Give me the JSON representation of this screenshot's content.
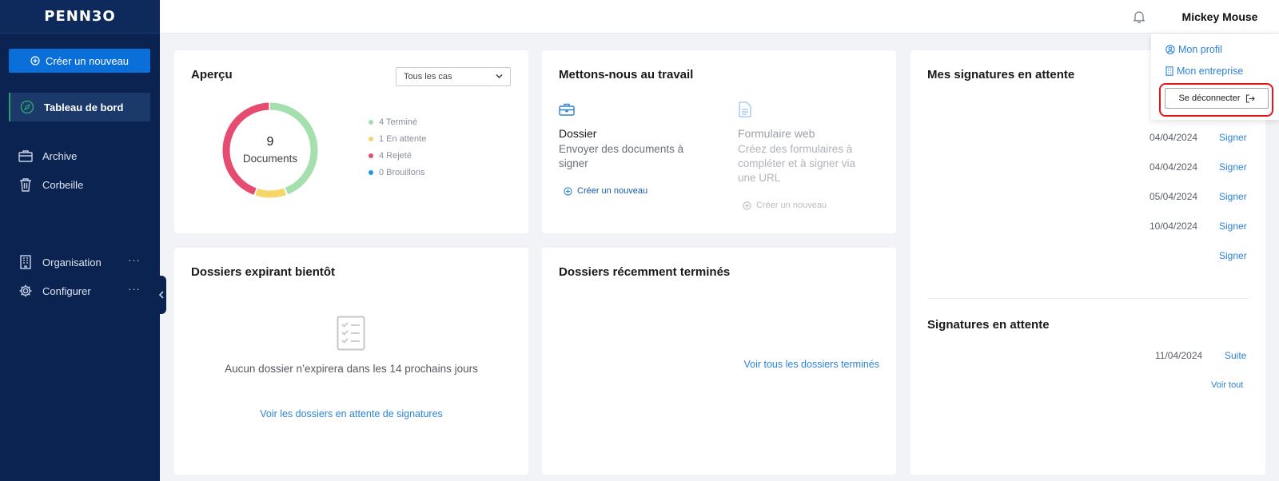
{
  "sidebar": {
    "logo": "PENN3O",
    "create_label": "Créer un nouveau",
    "items": [
      {
        "label": "Tableau de bord"
      },
      {
        "label": "Archive"
      },
      {
        "label": "Corbeille"
      },
      {
        "label": "Organisation",
        "more": "···"
      },
      {
        "label": "Configurer",
        "more": "···"
      }
    ]
  },
  "header": {
    "user_name": "Mickey Mouse"
  },
  "user_menu": {
    "profile": "Mon profil",
    "company": "Mon entreprise",
    "logout": "Se déconnecter"
  },
  "overview": {
    "title": "Aperçu",
    "filter_value": "Tous les cas",
    "center_count": "9",
    "center_label": "Documents",
    "legend": [
      {
        "label": "4 Terminé",
        "color": "#a5dfad"
      },
      {
        "label": "1 En attente",
        "color": "#f6d56b"
      },
      {
        "label": "4 Rejeté",
        "color": "#e64b70"
      },
      {
        "label": "0 Brouillons",
        "color": "#1d95e8"
      }
    ]
  },
  "chart_data": {
    "type": "pie",
    "categories": [
      "Terminé",
      "En attente",
      "Rejeté",
      "Brouillons"
    ],
    "values": [
      4,
      1,
      4,
      0
    ],
    "colors": [
      "#a5dfad",
      "#f6d56b",
      "#e64b70",
      "#1d95e8"
    ]
  },
  "work": {
    "title": "Mettons-nous au travail",
    "dossier_title": "Dossier",
    "dossier_desc": "Envoyer des documents à signer",
    "dossier_link": "Créer un nouveau",
    "form_title": "Formulaire web",
    "form_desc": "Créez des formulaires à compléter et à signer via une URL",
    "form_link": "Créer un nouveau"
  },
  "my_signatures": {
    "title": "Mes signatures en attente",
    "rows": [
      {
        "date": "04/04/2024",
        "action": "Signer"
      },
      {
        "date": "04/04/2024",
        "action": "Signer"
      },
      {
        "date": "05/04/2024",
        "action": "Signer"
      },
      {
        "date": "10/04/2024",
        "action": "Signer"
      },
      {
        "date": "",
        "action": "Signer"
      }
    ]
  },
  "pending_signatures": {
    "title": "Signatures en attente",
    "date": "11/04/2024",
    "action": "Suite",
    "see_all": "Voir tout"
  },
  "expiring": {
    "title": "Dossiers expirant bientôt",
    "empty_text": "Aucun dossier n’expirera dans les 14 prochains jours",
    "link": "Voir les dossiers en attente de signatures"
  },
  "completed": {
    "title": "Dossiers récemment terminés",
    "link": "Voir tous les dossiers terminés"
  }
}
